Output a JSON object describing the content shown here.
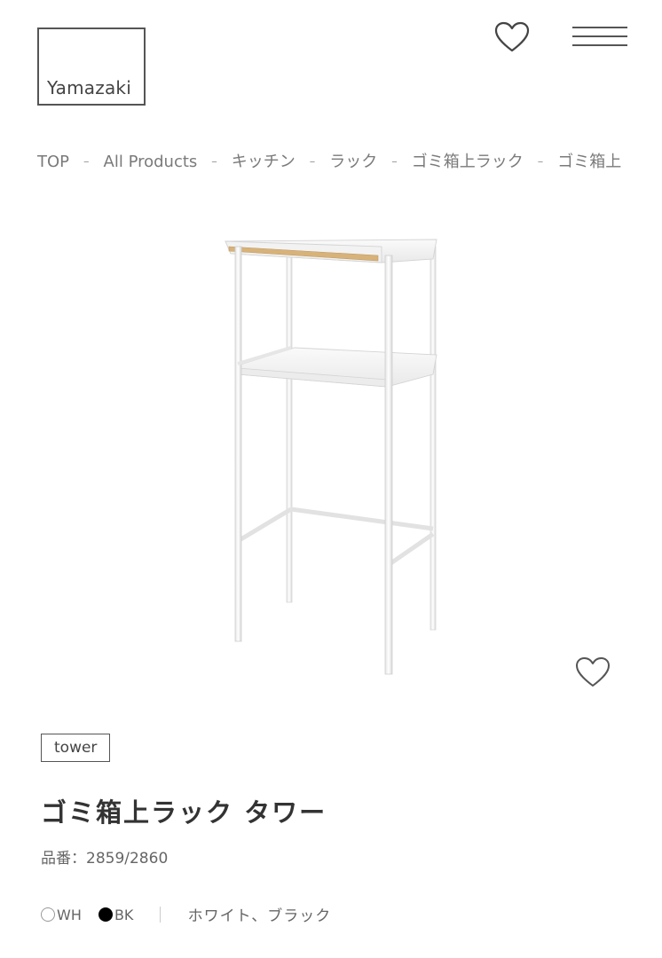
{
  "header": {
    "logo_text": "Yamazaki",
    "favorite_icon": "heart-outline-icon",
    "menu_icon": "hamburger-menu-icon"
  },
  "breadcrumb": {
    "items": [
      "TOP",
      "All Products",
      "キッチン",
      "ラック",
      "ゴミ箱上ラック",
      "ゴミ箱上"
    ],
    "separator": "–"
  },
  "product": {
    "image_alt": "ゴミ箱上ラック タワー",
    "favorite_icon": "heart-outline-icon",
    "series_tag": "tower",
    "title": "ゴミ箱上ラック タワー",
    "number_label": "品番：",
    "number_value": "2859/2860",
    "colors": [
      {
        "code": "WH",
        "swatch": "#ffffff"
      },
      {
        "code": "BK",
        "swatch": "#000000"
      }
    ],
    "color_names": "ホワイト、ブラック"
  }
}
